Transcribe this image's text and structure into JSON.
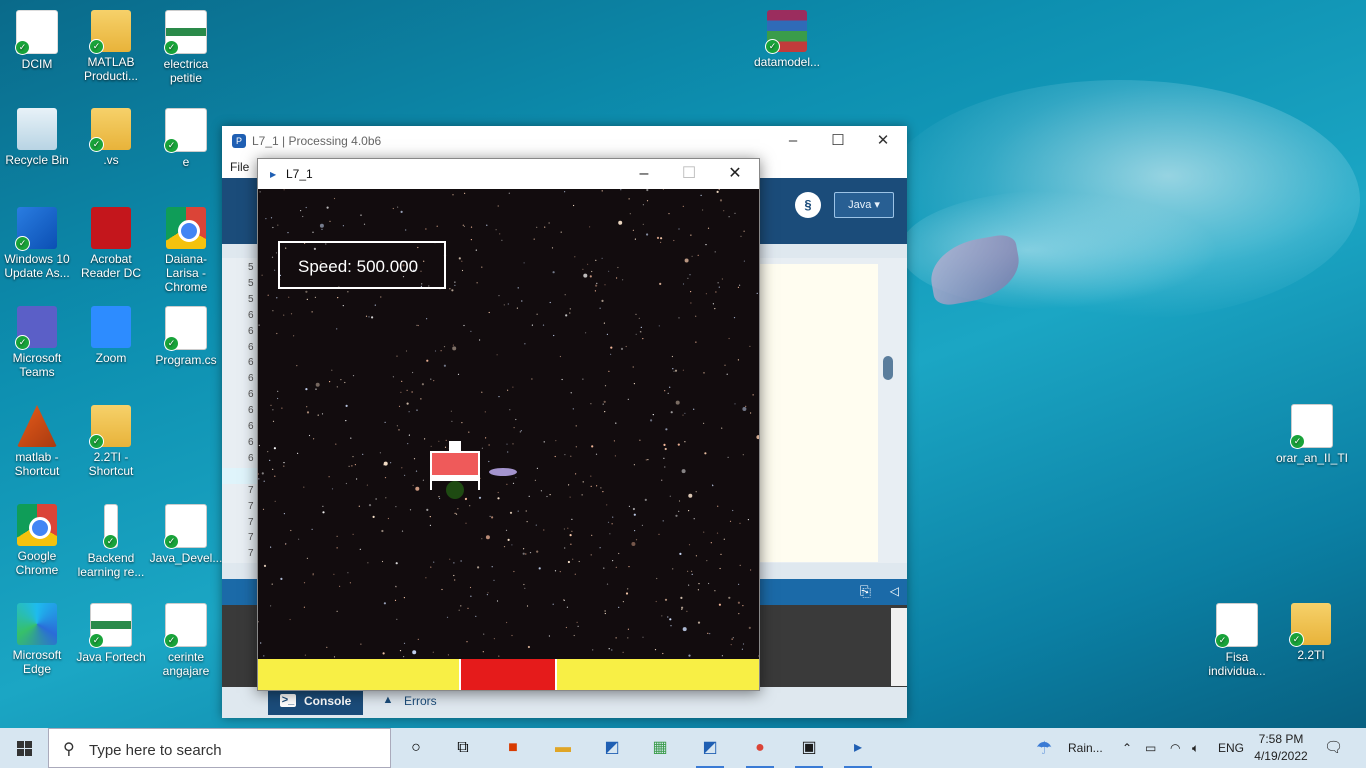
{
  "desktop": {
    "icons": [
      {
        "label": "DCIM"
      },
      {
        "label": "MATLAB Producti..."
      },
      {
        "label": "electrica petitie"
      },
      {
        "label": "Recycle Bin"
      },
      {
        "label": ".vs"
      },
      {
        "label": "e"
      },
      {
        "label": "Windows 10 Update As..."
      },
      {
        "label": "Acrobat Reader DC"
      },
      {
        "label": "Daiana-Larisa - Chrome"
      },
      {
        "label": "Microsoft Teams"
      },
      {
        "label": "Zoom"
      },
      {
        "label": "Program.cs"
      },
      {
        "label": "matlab - Shortcut"
      },
      {
        "label": "2.2TI - Shortcut"
      },
      {
        "label": "Google Chrome"
      },
      {
        "label": "Backend learning re..."
      },
      {
        "label": "Java_Devel..."
      },
      {
        "label": "Microsoft Edge"
      },
      {
        "label": "Java Fortech"
      },
      {
        "label": "cerinte angajare"
      },
      {
        "label": "datamodel..."
      },
      {
        "label": "orar_an_II_TI"
      },
      {
        "label": "Fisa individua..."
      },
      {
        "label": "2.2TI"
      }
    ]
  },
  "processing": {
    "title": "L7_1 | Processing 4.0b6",
    "menu_file": "File",
    "mode": "Java ▾",
    "line_numbers": [
      "5",
      "5",
      "5",
      "6",
      "6",
      "6",
      "6",
      "6",
      "6",
      "6",
      "6",
      "6",
      "6",
      "6",
      "7",
      "7",
      "7",
      "7",
      "7"
    ],
    "tabs": {
      "console": "Console",
      "errors": "Errors"
    }
  },
  "sketch": {
    "title": "L7_1",
    "speed_label": "Speed:",
    "speed_value": "500.000",
    "colors": {
      "pad": "#f8ef45",
      "landing": "#e51b1b",
      "ship": "#ef5a5a"
    }
  },
  "taskbar": {
    "search_placeholder": "Type here to search",
    "weather": "Rain...",
    "language": "ENG",
    "time": "7:58 PM",
    "date": "4/19/2022"
  }
}
